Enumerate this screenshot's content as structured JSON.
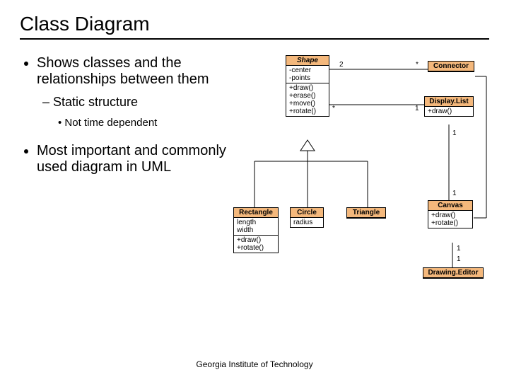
{
  "slide": {
    "title": "Class Diagram",
    "footer": "Georgia Institute of Technology"
  },
  "bullets": {
    "b1": "Shows classes and the relationships between them",
    "b1_sub1": "Static structure",
    "b1_sub1_sub1": "Not time dependent",
    "b2": "Most important and commonly used diagram in UML"
  },
  "uml": {
    "shape": {
      "name": "Shape",
      "attrs": "-center\n-points",
      "ops": "+draw()\n+erase()\n+move()\n+rotate()"
    },
    "connector": {
      "name": "Connector"
    },
    "displaylist": {
      "name": "Display.List",
      "ops": "+draw()"
    },
    "rectangle": {
      "name": "Rectangle",
      "attrs": "length\nwidth",
      "ops": "+draw()\n+rotate()"
    },
    "circle": {
      "name": "Circle",
      "attrs": "radius"
    },
    "triangle": {
      "name": "Triangle"
    },
    "canvas": {
      "name": "Canvas",
      "ops": "+draw()\n+rotate()"
    },
    "drawingeditor": {
      "name": "Drawing.Editor"
    }
  },
  "assoc_labels": {
    "two": "2",
    "star1": "*",
    "star2": "*",
    "one_dl": "1",
    "one_cv_top": "1",
    "one_cv_side": "1",
    "one_de_top": "1",
    "one_de_bot": "1"
  }
}
